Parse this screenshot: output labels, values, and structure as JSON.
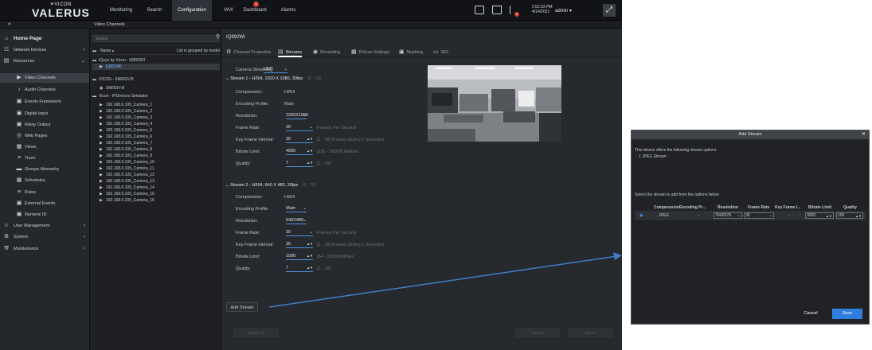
{
  "topbar": {
    "logo_top": "✳VICON",
    "logo_main": "VALERUS",
    "nav": [
      "Monitoring",
      "Search",
      "Configuration",
      "VAX",
      "Dashboard",
      "Alarms"
    ],
    "alarm_count": "1",
    "notif_count": "1",
    "time": "2:52:33 PM",
    "date": "4/14/2021",
    "user": "admin ▾"
  },
  "subbar": {
    "collapse": "«",
    "title": "Video Channels"
  },
  "leftnav": [
    {
      "label": "Home Page",
      "icon": "⌂"
    },
    {
      "label": "Network Devices",
      "icon": "☷"
    },
    {
      "label": "Resources",
      "icon": "▤"
    },
    {
      "label": "Video Channels",
      "icon": "▶"
    },
    {
      "label": "Audio Channels",
      "icon": "♪"
    },
    {
      "label": "Events Framework",
      "icon": "▣"
    },
    {
      "label": "Digital Input",
      "icon": "▣"
    },
    {
      "label": "Relay Output",
      "icon": "▣"
    },
    {
      "label": "Web Pages",
      "icon": "◎"
    },
    {
      "label": "Views",
      "icon": "▦"
    },
    {
      "label": "Tours",
      "icon": "≡"
    },
    {
      "label": "Groups Hierarchy",
      "icon": "▬"
    },
    {
      "label": "Schedules",
      "icon": "▦"
    },
    {
      "label": "Rules",
      "icon": "≡"
    },
    {
      "label": "External Events",
      "icon": "▣"
    },
    {
      "label": "Numeric ID",
      "icon": "▣"
    },
    {
      "label": "User Management",
      "icon": "☺"
    },
    {
      "label": "System",
      "icon": "⚙"
    },
    {
      "label": "Maintenance",
      "icon": "⚒"
    }
  ],
  "tree": {
    "search_placeholder": "Search",
    "header_name": "Name ▴",
    "header_group": "List is grouped by model",
    "items": [
      "IQeye by Vicon - IQ892WI",
      "IQ892WI",
      "VICON - SN663V-B",
      "SN663V-B",
      "Vicon - IPDevices Simulator",
      "192.168.0.105_Camera_1",
      "192.168.0.105_Camera_2",
      "192.168.0.105_Camera_3",
      "192.168.0.105_Camera_4",
      "192.168.0.105_Camera_5",
      "192.168.0.105_Camera_6",
      "192.168.0.105_Camera_7",
      "192.168.0.105_Camera_8",
      "192.168.0.105_Camera_9",
      "192.168.0.105_Camera_10",
      "192.168.0.105_Camera_11",
      "192.168.0.105_Camera_12",
      "192.168.0.105_Camera_13",
      "192.168.0.105_Camera_14",
      "192.168.0.105_Camera_15",
      "192.168.0.105_Camera_16"
    ]
  },
  "main": {
    "camera_title": "IQ892WI",
    "tabs": [
      "Channel Properties",
      "Streams",
      "Recording",
      "Picture Settings",
      "Masking",
      "360"
    ],
    "camera_streaming_label": "Camera Streaming:",
    "camera_streaming_value": "UDP",
    "stream1": {
      "title": "Stream 1 - H264, 1920 X 1080, 30fps",
      "compression_label": "Compression:",
      "compression": "H264",
      "profile_label": "Encoding Profile:",
      "profile": "Main",
      "resolution_label": "Resolution:",
      "resolution": "1920X1080",
      "framerate_label": "Frame Rate:",
      "framerate": "30",
      "framerate_hint": "Frames Per Second",
      "keyframe_label": "Key Frame Interval:",
      "keyframe": "30",
      "keyframe_hint": "[1 - 30] Frames (Every 1 Seconds)",
      "bitrate_label": "Bitrate Limit:",
      "bitrate": "4000",
      "bitrate_hint": "[150 - 50000] kbit/sec",
      "quality_label": "Quality:",
      "quality": "7",
      "quality_hint": "[1 - 10]"
    },
    "stream2": {
      "title": "Stream 2 - H264, 640 X 480, 30fps",
      "compression_label": "Compression:",
      "compression": "H264",
      "profile_label": "Encoding Profile:",
      "profile": "Main",
      "resolution_label": "Resolution:",
      "resolution": "640X480",
      "framerate_label": "Frame Rate:",
      "framerate": "30",
      "framerate_hint": "Frames Per Second",
      "keyframe_label": "Key Frame Interval:",
      "keyframe": "30",
      "keyframe_hint": "[1 - 30] Frames (Every 1 Seconds)",
      "bitrate_label": "Bitrate Limit:",
      "bitrate": "1000",
      "bitrate_hint": "[64 - 2000] kbit/sec",
      "quality_label": "Quality:",
      "quality": "7",
      "quality_hint": "[1 - 10]"
    },
    "add_stream": "Add Stream",
    "apply_to": "Apply To",
    "cancel": "Cancel",
    "save": "Save"
  },
  "dialog": {
    "title": "Add Stream",
    "close": "✕",
    "offers_line": "This device offers the following stream options",
    "option_line": "- 1 JPEG Stream",
    "select_line": "Select the stream to add from the options below",
    "headers": [
      "Compression",
      "Encoding Pr...",
      "Resolution",
      "Frame Rate",
      "Key Frame I...",
      "Bitrate Limit",
      "Quality"
    ],
    "row": {
      "compression": "JPEG",
      "encoding": "-",
      "resolution": "704X576",
      "framerate": "30",
      "keyframe": "-",
      "bitrate": "3000",
      "quality": "100"
    },
    "cancel": "Cancel",
    "save": "Save"
  },
  "colors": {
    "accent": "#2f7de1",
    "alarm": "#d63a2e",
    "arrow": "#3f7fc8"
  }
}
